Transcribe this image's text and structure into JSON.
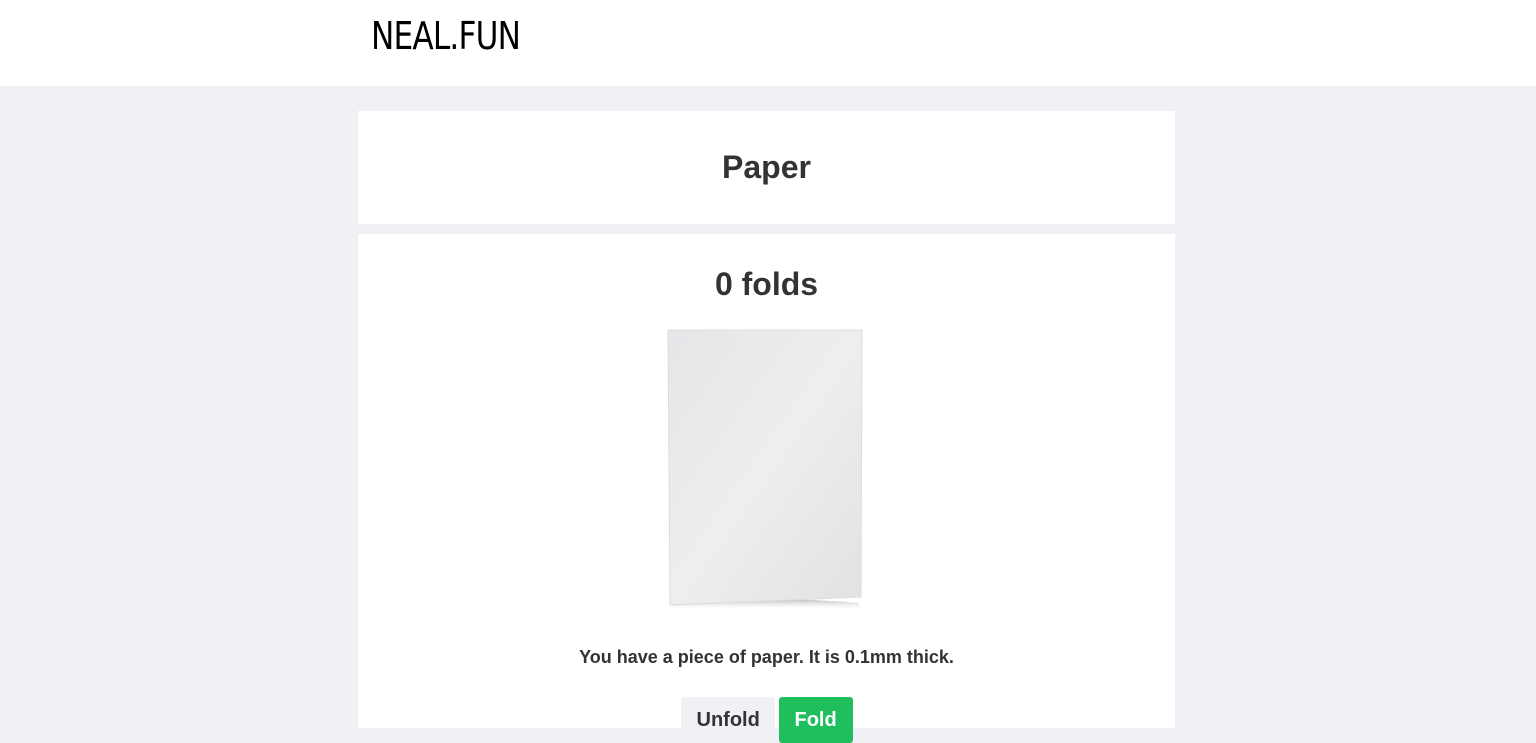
{
  "header": {
    "logo_text": "NEAL.FUN"
  },
  "page": {
    "title": "Paper"
  },
  "main": {
    "fold_count_label": "0 folds",
    "description": "You have a piece of paper. It is 0.1mm thick.",
    "buttons": {
      "unfold_label": "Unfold",
      "fold_label": "Fold"
    }
  },
  "colors": {
    "background": "#eff1f4",
    "card": "#ffffff",
    "text": "#333333",
    "fold_button": "#1fbf5e",
    "unfold_button": "#eff1f4"
  },
  "icons": {
    "paper": "paper-sheet-image"
  }
}
